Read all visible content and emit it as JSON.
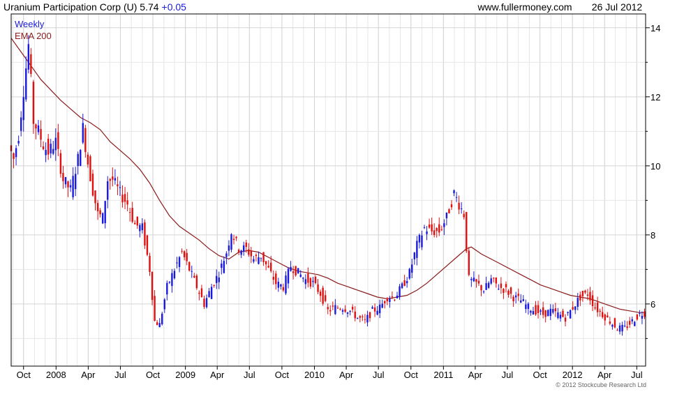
{
  "header": {
    "title": "Uranium Participation Corp (U) 5.74",
    "change": "+0.05",
    "site": "www.fullermoney.com",
    "date": "26 Jul 2012"
  },
  "footer": {
    "copyright": "© 2012 Stockcube Research Ltd"
  },
  "colors": {
    "up": "#1a1adc",
    "down": "#e01010",
    "ema": "#8b1a1a",
    "grid": "#d4d4d4",
    "axis": "#000000",
    "title_text": "#000000",
    "change_text": "#1a1adc"
  },
  "chart_data": {
    "type": "line",
    "chart_kind": "weekly candlestick with moving average",
    "legend": [
      {
        "label": "Weekly",
        "color": "#1a1adc"
      },
      {
        "label": "EMA 200",
        "color": "#8b1a1a"
      }
    ],
    "legend_position": "top-left",
    "x_range": [
      "2007-08-27",
      "2012-07-26"
    ],
    "y_range": [
      4.2,
      14.4
    ],
    "y_axis_side": "right",
    "grid": true,
    "x_ticks": [
      {
        "label": "Oct",
        "date": "2007-10-01"
      },
      {
        "label": "2008",
        "date": "2008-01-01"
      },
      {
        "label": "Apr",
        "date": "2008-04-01"
      },
      {
        "label": "Jul",
        "date": "2008-07-01"
      },
      {
        "label": "Oct",
        "date": "2008-10-01"
      },
      {
        "label": "2009",
        "date": "2009-01-01"
      },
      {
        "label": "Apr",
        "date": "2009-04-01"
      },
      {
        "label": "Jul",
        "date": "2009-07-01"
      },
      {
        "label": "Oct",
        "date": "2009-10-01"
      },
      {
        "label": "2010",
        "date": "2010-01-01"
      },
      {
        "label": "Apr",
        "date": "2010-04-01"
      },
      {
        "label": "Jul",
        "date": "2010-07-01"
      },
      {
        "label": "Oct",
        "date": "2010-10-01"
      },
      {
        "label": "2011",
        "date": "2011-01-01"
      },
      {
        "label": "Apr",
        "date": "2011-04-01"
      },
      {
        "label": "Jul",
        "date": "2011-07-01"
      },
      {
        "label": "Oct",
        "date": "2011-10-01"
      },
      {
        "label": "2012",
        "date": "2012-01-01"
      },
      {
        "label": "Apr",
        "date": "2012-04-01"
      },
      {
        "label": "Jul",
        "date": "2012-07-01"
      }
    ],
    "y_ticks": [
      6,
      8,
      10,
      12,
      14
    ],
    "price_path": [
      [
        "2007-08-27",
        10.6
      ],
      [
        "2007-09-10",
        10.2
      ],
      [
        "2007-09-24",
        10.9
      ],
      [
        "2007-10-08",
        12.2
      ],
      [
        "2007-10-22",
        13.5
      ],
      [
        "2007-11-05",
        11.3
      ],
      [
        "2007-11-19",
        11.0
      ],
      [
        "2007-12-03",
        10.6
      ],
      [
        "2007-12-17",
        10.4
      ],
      [
        "2008-01-07",
        10.7
      ],
      [
        "2008-01-28",
        9.6
      ],
      [
        "2008-02-18",
        9.3
      ],
      [
        "2008-03-10",
        10.2
      ],
      [
        "2008-03-24",
        11.1
      ],
      [
        "2008-04-07",
        10.1
      ],
      [
        "2008-04-21",
        9.3
      ],
      [
        "2008-05-05",
        8.6
      ],
      [
        "2008-05-19",
        8.5
      ],
      [
        "2008-06-02",
        9.6
      ],
      [
        "2008-06-16",
        9.6
      ],
      [
        "2008-07-07",
        9.2
      ],
      [
        "2008-07-28",
        8.9
      ],
      [
        "2008-08-18",
        8.3
      ],
      [
        "2008-09-08",
        8.2
      ],
      [
        "2008-09-29",
        7.0
      ],
      [
        "2008-10-13",
        5.5
      ],
      [
        "2008-10-27",
        5.4
      ],
      [
        "2008-11-17",
        6.5
      ],
      [
        "2008-12-08",
        7.0
      ],
      [
        "2008-12-29",
        7.5
      ],
      [
        "2009-01-19",
        7.0
      ],
      [
        "2009-02-09",
        6.5
      ],
      [
        "2009-03-02",
        6.0
      ],
      [
        "2009-03-23",
        6.5
      ],
      [
        "2009-04-13",
        6.9
      ],
      [
        "2009-05-04",
        7.5
      ],
      [
        "2009-05-18",
        8.1
      ],
      [
        "2009-06-08",
        7.6
      ],
      [
        "2009-06-29",
        7.6
      ],
      [
        "2009-07-20",
        7.3
      ],
      [
        "2009-08-10",
        7.4
      ],
      [
        "2009-08-31",
        7.0
      ],
      [
        "2009-09-21",
        6.6
      ],
      [
        "2009-10-12",
        6.5
      ],
      [
        "2009-11-02",
        7.1
      ],
      [
        "2009-11-23",
        6.9
      ],
      [
        "2009-12-14",
        6.7
      ],
      [
        "2010-01-04",
        6.6
      ],
      [
        "2010-01-25",
        6.3
      ],
      [
        "2010-02-15",
        5.8
      ],
      [
        "2010-03-08",
        5.9
      ],
      [
        "2010-03-29",
        5.9
      ],
      [
        "2010-04-19",
        5.8
      ],
      [
        "2010-05-10",
        5.6
      ],
      [
        "2010-05-31",
        5.5
      ],
      [
        "2010-06-21",
        5.8
      ],
      [
        "2010-07-12",
        5.9
      ],
      [
        "2010-08-02",
        6.2
      ],
      [
        "2010-08-23",
        6.2
      ],
      [
        "2010-09-13",
        6.5
      ],
      [
        "2010-10-04",
        6.9
      ],
      [
        "2010-10-25",
        7.7
      ],
      [
        "2010-11-15",
        8.2
      ],
      [
        "2010-12-06",
        8.1
      ],
      [
        "2010-12-27",
        8.1
      ],
      [
        "2011-01-17",
        8.5
      ],
      [
        "2011-02-07",
        9.2
      ],
      [
        "2011-02-21",
        8.9
      ],
      [
        "2011-03-07",
        8.6
      ],
      [
        "2011-03-21",
        6.7
      ],
      [
        "2011-04-11",
        6.6
      ],
      [
        "2011-05-02",
        6.4
      ],
      [
        "2011-05-23",
        6.7
      ],
      [
        "2011-06-13",
        6.5
      ],
      [
        "2011-07-04",
        6.4
      ],
      [
        "2011-07-25",
        6.2
      ],
      [
        "2011-08-15",
        6.1
      ],
      [
        "2011-09-05",
        5.9
      ],
      [
        "2011-09-26",
        5.8
      ],
      [
        "2011-10-17",
        5.7
      ],
      [
        "2011-11-07",
        5.8
      ],
      [
        "2011-11-28",
        5.7
      ],
      [
        "2011-12-19",
        5.6
      ],
      [
        "2012-01-09",
        5.9
      ],
      [
        "2012-01-30",
        6.2
      ],
      [
        "2012-02-20",
        6.3
      ],
      [
        "2012-03-12",
        5.9
      ],
      [
        "2012-04-02",
        5.7
      ],
      [
        "2012-04-23",
        5.5
      ],
      [
        "2012-05-14",
        5.3
      ],
      [
        "2012-06-04",
        5.3
      ],
      [
        "2012-06-25",
        5.5
      ],
      [
        "2012-07-16",
        5.7
      ],
      [
        "2012-07-26",
        5.74
      ]
    ],
    "ema_200": [
      [
        "2007-08-27",
        13.7
      ],
      [
        "2007-09-24",
        13.3
      ],
      [
        "2007-10-22",
        12.9
      ],
      [
        "2007-11-19",
        12.5
      ],
      [
        "2007-12-17",
        12.2
      ],
      [
        "2008-01-14",
        11.9
      ],
      [
        "2008-02-11",
        11.65
      ],
      [
        "2008-03-10",
        11.4
      ],
      [
        "2008-04-07",
        11.25
      ],
      [
        "2008-05-05",
        11.05
      ],
      [
        "2008-06-02",
        10.7
      ],
      [
        "2008-06-30",
        10.45
      ],
      [
        "2008-07-28",
        10.2
      ],
      [
        "2008-08-25",
        9.9
      ],
      [
        "2008-09-22",
        9.5
      ],
      [
        "2008-10-20",
        9.0
      ],
      [
        "2008-11-17",
        8.55
      ],
      [
        "2008-12-15",
        8.25
      ],
      [
        "2009-01-12",
        8.05
      ],
      [
        "2009-02-09",
        7.85
      ],
      [
        "2009-03-09",
        7.6
      ],
      [
        "2009-04-06",
        7.4
      ],
      [
        "2009-05-04",
        7.3
      ],
      [
        "2009-06-01",
        7.5
      ],
      [
        "2009-06-29",
        7.55
      ],
      [
        "2009-07-27",
        7.5
      ],
      [
        "2009-08-24",
        7.35
      ],
      [
        "2009-09-21",
        7.2
      ],
      [
        "2009-10-19",
        7.05
      ],
      [
        "2009-11-16",
        6.95
      ],
      [
        "2009-12-14",
        6.9
      ],
      [
        "2010-01-11",
        6.85
      ],
      [
        "2010-02-08",
        6.75
      ],
      [
        "2010-03-08",
        6.6
      ],
      [
        "2010-04-05",
        6.5
      ],
      [
        "2010-05-03",
        6.4
      ],
      [
        "2010-05-31",
        6.3
      ],
      [
        "2010-06-28",
        6.2
      ],
      [
        "2010-07-26",
        6.15
      ],
      [
        "2010-08-23",
        6.2
      ],
      [
        "2010-09-20",
        6.25
      ],
      [
        "2010-10-18",
        6.4
      ],
      [
        "2010-11-15",
        6.6
      ],
      [
        "2010-12-13",
        6.85
      ],
      [
        "2011-01-10",
        7.1
      ],
      [
        "2011-02-07",
        7.35
      ],
      [
        "2011-03-07",
        7.6
      ],
      [
        "2011-03-21",
        7.65
      ],
      [
        "2011-04-18",
        7.45
      ],
      [
        "2011-05-16",
        7.3
      ],
      [
        "2011-06-13",
        7.15
      ],
      [
        "2011-07-11",
        7.0
      ],
      [
        "2011-08-08",
        6.85
      ],
      [
        "2011-09-05",
        6.7
      ],
      [
        "2011-10-03",
        6.55
      ],
      [
        "2011-10-31",
        6.45
      ],
      [
        "2011-11-28",
        6.35
      ],
      [
        "2011-12-26",
        6.25
      ],
      [
        "2012-01-23",
        6.2
      ],
      [
        "2012-02-20",
        6.15
      ],
      [
        "2012-03-19",
        6.05
      ],
      [
        "2012-04-16",
        5.95
      ],
      [
        "2012-05-14",
        5.85
      ],
      [
        "2012-06-11",
        5.8
      ],
      [
        "2012-07-09",
        5.75
      ],
      [
        "2012-07-26",
        5.75
      ]
    ]
  }
}
